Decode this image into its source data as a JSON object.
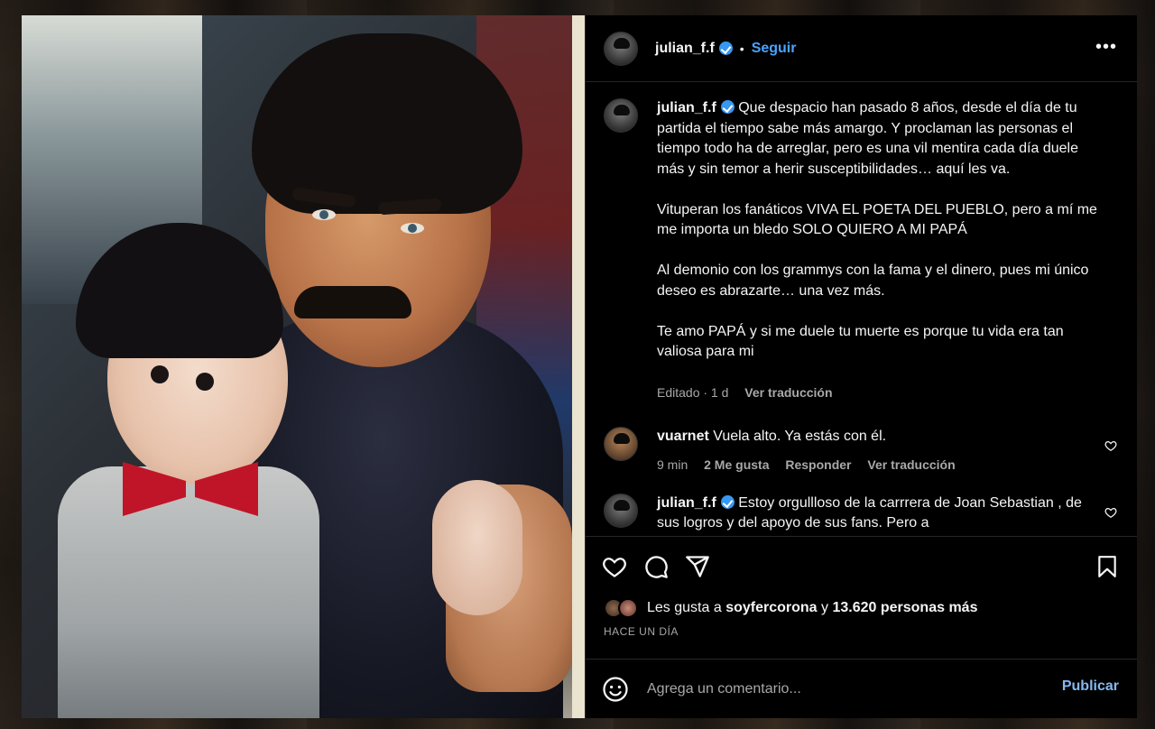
{
  "post": {
    "username": "julian_f.f",
    "follow_label": "Seguir",
    "separator": "•",
    "more_label": "•••"
  },
  "caption": {
    "username": "julian_f.f",
    "paragraphs": [
      "Que despacio han pasado 8 años, desde el día de tu partida el tiempo sabe más amargo. Y proclaman las personas el tiempo todo ha de arreglar, pero es una vil mentira cada día duele más y sin temor a herir susceptibilidades… aquí les va.",
      "Vituperan los fanáticos VIVA EL POETA DEL PUEBLO, pero a mí me me importa un bledo SOLO QUIERO A MI PAPÁ",
      "Al demonio con los grammys con la fama y el dinero, pues mi único deseo es abrazarte… una vez más.",
      "Te amo PAPÁ y si me duele tu muerte es porque tu vida era tan valiosa para mi"
    ],
    "edited": "Editado · 1 d",
    "translate": "Ver traducción"
  },
  "comments": [
    {
      "username": "vuarnet",
      "text": "Vuela alto. Ya estás con él.",
      "time": "9 min",
      "likes": "2 Me gusta",
      "reply": "Responder",
      "translate": "Ver traducción",
      "verified": false
    },
    {
      "username": "julian_f.f",
      "text": "Estoy orgullloso de la carrrera de Joan Sebastian , de sus logros y del apoyo de sus fans. Pero a",
      "verified": true
    }
  ],
  "likes": {
    "prefix": "Les gusta a",
    "user": "soyfercorona",
    "conj": "y",
    "others": "13.620 personas más"
  },
  "timestamp": "HACE UN DÍA",
  "composer": {
    "placeholder": "Agrega un comentario...",
    "publish": "Publicar"
  },
  "colors": {
    "accent": "#4aa3ff",
    "verified": "#3897f0",
    "muted": "#a8a8a8",
    "panel_bg": "#000000"
  },
  "icons": [
    "heart-icon",
    "comment-icon",
    "share-icon",
    "bookmark-icon",
    "emoji-icon",
    "verified-icon",
    "more-icon"
  ]
}
